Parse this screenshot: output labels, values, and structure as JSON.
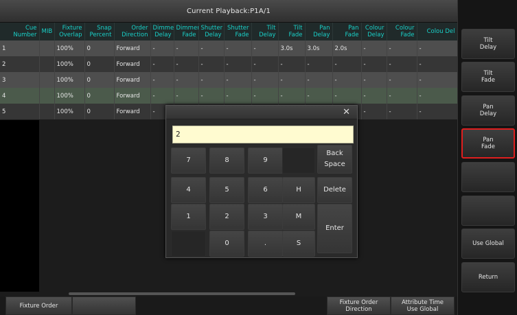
{
  "title": "Current Playback:P1A/1",
  "table": {
    "headers": [
      "Cue Number",
      "MIB",
      "Fixture Overlap",
      "Snap Percent",
      "Order Direction",
      "Dimmer Delay",
      "Dimmer Fade",
      "Shutter Delay",
      "Shutter Fade",
      "Tilt Delay",
      "Tilt Fade",
      "Pan Delay",
      "Pan Fade",
      "Colour Delay",
      "Colour Fade",
      "Colou Del"
    ],
    "rows": [
      [
        "1",
        "",
        "100%",
        "0",
        "Forward",
        "-",
        "-",
        "-",
        "-",
        "-",
        "3.0s",
        "3.0s",
        "2.0s",
        "-",
        "-",
        "-"
      ],
      [
        "2",
        "",
        "100%",
        "0",
        "Forward",
        "-",
        "-",
        "-",
        "-",
        "-",
        "-",
        "-",
        "-",
        "-",
        "-",
        "-"
      ],
      [
        "3",
        "",
        "100%",
        "0",
        "Forward",
        "-",
        "-",
        "-",
        "-",
        "-",
        "-",
        "-",
        "-",
        "-",
        "-",
        "-"
      ],
      [
        "4",
        "",
        "100%",
        "0",
        "Forward",
        "-",
        "-",
        "-",
        "-",
        "-",
        "-",
        "-",
        "-",
        "-",
        "-",
        "-"
      ],
      [
        "5",
        "",
        "100%",
        "0",
        "Forward",
        "-",
        "-",
        "-",
        "-",
        "-",
        "-",
        "-",
        "-",
        "-",
        "-",
        "-"
      ]
    ]
  },
  "keypad": {
    "display_value": "2",
    "close": "✕",
    "keys": {
      "k7": "7",
      "k8": "8",
      "k9": "9",
      "back": "Back\nSpace",
      "k4": "4",
      "k5": "5",
      "k6": "6",
      "h": "H",
      "del": "Delete",
      "k1": "1",
      "k2": "2",
      "k3": "3",
      "m": "M",
      "enter": "Enter",
      "k0": "0",
      "dot": ".",
      "s": "S"
    }
  },
  "side_buttons": {
    "tilt_delay": "Tilt\nDelay",
    "tilt_fade": "Tilt\nFade",
    "pan_delay": "Pan\nDelay",
    "pan_fade": "Pan\nFade",
    "use_global": "Use Global",
    "return": "Return"
  },
  "bottom_buttons": {
    "fixture_order": "Fixture Order",
    "fixture_order_direction": "Fixture Order\nDirection",
    "attribute_time": "Attribute Time\nUse Global"
  },
  "colors": {
    "header_text": "#19d0c8",
    "active_border": "#e01e1e",
    "display_bg": "#fffbd0"
  }
}
